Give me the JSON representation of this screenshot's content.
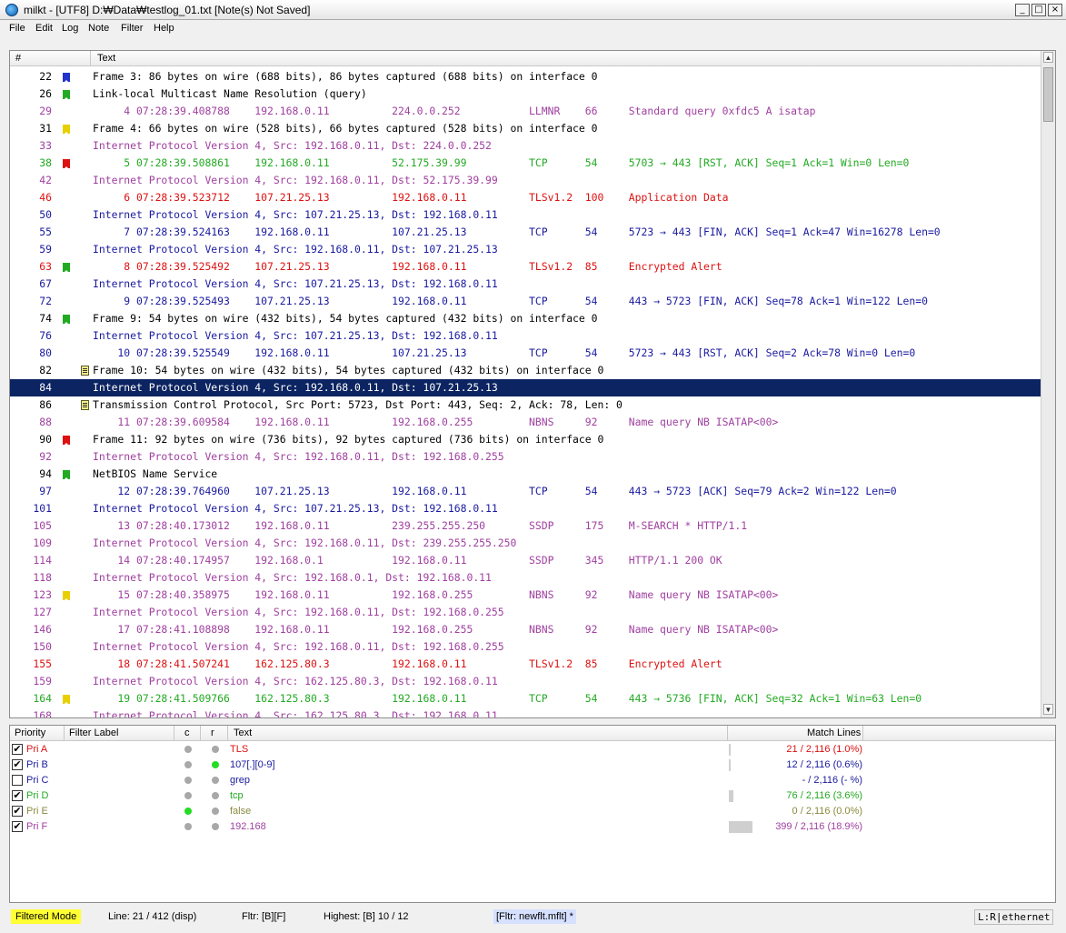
{
  "title": "milkt - [UTF8] D:₩Data₩testlog_01.txt [Note(s) Not Saved]",
  "window_buttons": [
    "_",
    "□",
    "×"
  ],
  "menu": [
    "File",
    "Edit",
    "Log",
    "Note",
    "Filter",
    "Help"
  ],
  "log": {
    "col_num": "#",
    "col_text": "Text",
    "rows": [
      {
        "n": "22",
        "mark": "flag",
        "mc": "#2233cc",
        "tc": "#000000",
        "t": "Frame 3: 86 bytes on wire (688 bits), 86 bytes captured (688 bits) on interface 0"
      },
      {
        "n": "26",
        "mark": "flag",
        "mc": "#22aa22",
        "tc": "#000000",
        "t": "Link-local Multicast Name Resolution (query)"
      },
      {
        "n": "29",
        "mark": "",
        "mc": "",
        "tc": "#a040a0",
        "t": "     4 07:28:39.408788    192.168.0.11          224.0.0.252           LLMNR    66     Standard query 0xfdc5 A isatap"
      },
      {
        "n": "31",
        "mark": "flag",
        "mc": "#e8d000",
        "tc": "#000000",
        "t": "Frame 4: 66 bytes on wire (528 bits), 66 bytes captured (528 bits) on interface 0"
      },
      {
        "n": "33",
        "mark": "",
        "mc": "",
        "tc": "#a040a0",
        "t": "Internet Protocol Version 4, Src: 192.168.0.11, Dst: 224.0.0.252"
      },
      {
        "n": "38",
        "mark": "flag",
        "mc": "#dd1111",
        "tc": "#22aa22",
        "t": "     5 07:28:39.508861    192.168.0.11          52.175.39.99          TCP      54     5703 → 443 [RST, ACK] Seq=1 Ack=1 Win=0 Len=0"
      },
      {
        "n": "42",
        "mark": "",
        "mc": "",
        "tc": "#a040a0",
        "t": "Internet Protocol Version 4, Src: 192.168.0.11, Dst: 52.175.39.99"
      },
      {
        "n": "46",
        "mark": "",
        "mc": "",
        "tc": "#dd1111",
        "t": "     6 07:28:39.523712    107.21.25.13          192.168.0.11          TLSv1.2  100    Application Data"
      },
      {
        "n": "50",
        "mark": "",
        "mc": "",
        "tc": "#1a1aa0",
        "t": "Internet Protocol Version 4, Src: 107.21.25.13, Dst: 192.168.0.11"
      },
      {
        "n": "55",
        "mark": "",
        "mc": "",
        "tc": "#1a1aa0",
        "t": "     7 07:28:39.524163    192.168.0.11          107.21.25.13          TCP      54     5723 → 443 [FIN, ACK] Seq=1 Ack=47 Win=16278 Len=0"
      },
      {
        "n": "59",
        "mark": "",
        "mc": "",
        "tc": "#1a1aa0",
        "t": "Internet Protocol Version 4, Src: 192.168.0.11, Dst: 107.21.25.13"
      },
      {
        "n": "63",
        "mark": "flag",
        "mc": "#22aa22",
        "tc": "#dd1111",
        "t": "     8 07:28:39.525492    107.21.25.13          192.168.0.11          TLSv1.2  85     Encrypted Alert"
      },
      {
        "n": "67",
        "mark": "",
        "mc": "",
        "tc": "#1a1aa0",
        "t": "Internet Protocol Version 4, Src: 107.21.25.13, Dst: 192.168.0.11"
      },
      {
        "n": "72",
        "mark": "",
        "mc": "",
        "tc": "#1a1aa0",
        "t": "     9 07:28:39.525493    107.21.25.13          192.168.0.11          TCP      54     443 → 5723 [FIN, ACK] Seq=78 Ack=1 Win=122 Len=0"
      },
      {
        "n": "74",
        "mark": "flag",
        "mc": "#22aa22",
        "tc": "#000000",
        "t": "Frame 9: 54 bytes on wire (432 bits), 54 bytes captured (432 bits) on interface 0"
      },
      {
        "n": "76",
        "mark": "",
        "mc": "",
        "tc": "#1a1aa0",
        "t": "Internet Protocol Version 4, Src: 107.21.25.13, Dst: 192.168.0.11"
      },
      {
        "n": "80",
        "mark": "",
        "mc": "",
        "tc": "#1a1aa0",
        "t": "    10 07:28:39.525549    192.168.0.11          107.21.25.13          TCP      54     5723 → 443 [RST, ACK] Seq=2 Ack=78 Win=0 Len=0"
      },
      {
        "n": "82",
        "mark": "note",
        "mc": "",
        "tc": "#000000",
        "t": "Frame 10: 54 bytes on wire (432 bits), 54 bytes captured (432 bits) on interface 0"
      },
      {
        "n": "84",
        "mark": "",
        "mc": "",
        "tc": "#ffffff",
        "t": "Internet Protocol Version 4, Src: 192.168.0.11, Dst: 107.21.25.13",
        "sel": true
      },
      {
        "n": "86",
        "mark": "note",
        "mc": "",
        "tc": "#000000",
        "t": "Transmission Control Protocol, Src Port: 5723, Dst Port: 443, Seq: 2, Ack: 78, Len: 0"
      },
      {
        "n": "88",
        "mark": "",
        "mc": "",
        "tc": "#a040a0",
        "t": "    11 07:28:39.609584    192.168.0.11          192.168.0.255         NBNS     92     Name query NB ISATAP<00>"
      },
      {
        "n": "90",
        "mark": "flag",
        "mc": "#dd1111",
        "tc": "#000000",
        "t": "Frame 11: 92 bytes on wire (736 bits), 92 bytes captured (736 bits) on interface 0"
      },
      {
        "n": "92",
        "mark": "",
        "mc": "",
        "tc": "#a040a0",
        "t": "Internet Protocol Version 4, Src: 192.168.0.11, Dst: 192.168.0.255"
      },
      {
        "n": "94",
        "mark": "flag",
        "mc": "#22aa22",
        "tc": "#000000",
        "t": "NetBIOS Name Service"
      },
      {
        "n": "97",
        "mark": "",
        "mc": "",
        "tc": "#1a1aa0",
        "t": "    12 07:28:39.764960    107.21.25.13          192.168.0.11          TCP      54     443 → 5723 [ACK] Seq=79 Ack=2 Win=122 Len=0"
      },
      {
        "n": "101",
        "mark": "",
        "mc": "",
        "tc": "#1a1aa0",
        "t": "Internet Protocol Version 4, Src: 107.21.25.13, Dst: 192.168.0.11"
      },
      {
        "n": "105",
        "mark": "",
        "mc": "",
        "tc": "#a040a0",
        "t": "    13 07:28:40.173012    192.168.0.11          239.255.255.250       SSDP     175    M-SEARCH * HTTP/1.1"
      },
      {
        "n": "109",
        "mark": "",
        "mc": "",
        "tc": "#a040a0",
        "t": "Internet Protocol Version 4, Src: 192.168.0.11, Dst: 239.255.255.250"
      },
      {
        "n": "114",
        "mark": "",
        "mc": "",
        "tc": "#a040a0",
        "t": "    14 07:28:40.174957    192.168.0.1           192.168.0.11          SSDP     345    HTTP/1.1 200 OK"
      },
      {
        "n": "118",
        "mark": "",
        "mc": "",
        "tc": "#a040a0",
        "t": "Internet Protocol Version 4, Src: 192.168.0.1, Dst: 192.168.0.11"
      },
      {
        "n": "123",
        "mark": "flag",
        "mc": "#e8d000",
        "tc": "#a040a0",
        "t": "    15 07:28:40.358975    192.168.0.11          192.168.0.255         NBNS     92     Name query NB ISATAP<00>"
      },
      {
        "n": "127",
        "mark": "",
        "mc": "",
        "tc": "#a040a0",
        "t": "Internet Protocol Version 4, Src: 192.168.0.11, Dst: 192.168.0.255"
      },
      {
        "n": "146",
        "mark": "",
        "mc": "",
        "tc": "#a040a0",
        "t": "    17 07:28:41.108898    192.168.0.11          192.168.0.255         NBNS     92     Name query NB ISATAP<00>"
      },
      {
        "n": "150",
        "mark": "",
        "mc": "",
        "tc": "#a040a0",
        "t": "Internet Protocol Version 4, Src: 192.168.0.11, Dst: 192.168.0.255"
      },
      {
        "n": "155",
        "mark": "",
        "mc": "",
        "tc": "#dd1111",
        "t": "    18 07:28:41.507241    162.125.80.3          192.168.0.11          TLSv1.2  85     Encrypted Alert"
      },
      {
        "n": "159",
        "mark": "",
        "mc": "",
        "tc": "#a040a0",
        "t": "Internet Protocol Version 4, Src: 162.125.80.3, Dst: 192.168.0.11"
      },
      {
        "n": "164",
        "mark": "flag",
        "mc": "#e8d000",
        "tc": "#22aa22",
        "t": "    19 07:28:41.509766    162.125.80.3          192.168.0.11          TCP      54     443 → 5736 [FIN, ACK] Seq=32 Ack=1 Win=63 Len=0"
      },
      {
        "n": "168",
        "mark": "",
        "mc": "",
        "tc": "#a040a0",
        "t": "Internet Protocol Version 4, Src: 162.125.80.3, Dst: 192.168.0.11"
      }
    ]
  },
  "filters": {
    "headers": {
      "priority": "Priority",
      "label": "Filter Label",
      "c": "c",
      "r": "r",
      "text": "Text",
      "match": "Match Lines"
    },
    "rows": [
      {
        "checked": true,
        "pri": "Pri A",
        "text": "TLS",
        "match": "21 / 2,116 (1.0%)",
        "color": "#dd1111",
        "c": "#a8a8a8",
        "r": "#a8a8a8",
        "fraction": 0.01
      },
      {
        "checked": true,
        "pri": "Pri B",
        "text": "107[.][0-9]",
        "match": "12 / 2,116 (0.6%)",
        "color": "#1a1aa0",
        "c": "#a8a8a8",
        "r": "#22dd22",
        "fraction": 0.006
      },
      {
        "checked": false,
        "pri": "Pri C",
        "text": "grep",
        "match": "- / 2,116 (- %)",
        "color": "#1a1aa0",
        "c": "#a8a8a8",
        "r": "#a8a8a8",
        "fraction": 0
      },
      {
        "checked": true,
        "pri": "Pri D",
        "text": "tcp",
        "match": "76 / 2,116 (3.6%)",
        "color": "#22aa22",
        "c": "#a8a8a8",
        "r": "#a8a8a8",
        "fraction": 0.036
      },
      {
        "checked": true,
        "pri": "Pri E",
        "text": "false",
        "match": "0 / 2,116 (0.0%)",
        "color": "#8a8a40",
        "c": "#22dd22",
        "r": "#a8a8a8",
        "fraction": 0
      },
      {
        "checked": true,
        "pri": "Pri F",
        "text": "192.168",
        "match": "399 / 2,116 (18.9%)",
        "color": "#a040a0",
        "c": "#a8a8a8",
        "r": "#a8a8a8",
        "fraction": 0.189
      }
    ]
  },
  "status": {
    "mode": "Filtered Mode",
    "line": "Line: 21 / 412 (disp)",
    "fltr": "Fltr: [B][F]",
    "highest": "Highest: [B] 10 / 12",
    "file": "[Fltr: newflt.mflt] *",
    "right": "L:R|ethernet"
  },
  "colors": {
    "mode_bg": "#ffff33",
    "file_bg": "#d6e0ff",
    "selected": "#0c2461"
  }
}
